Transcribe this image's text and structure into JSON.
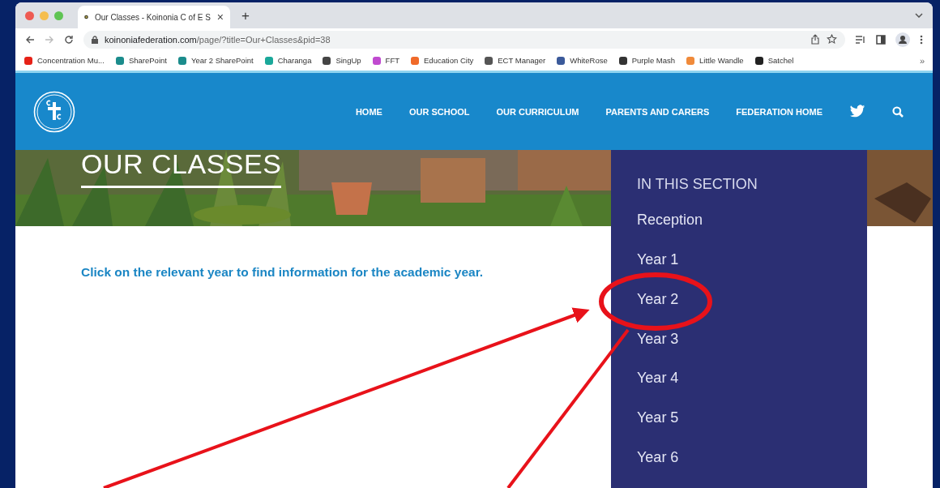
{
  "browser": {
    "tab_title": "Our Classes - Koinonia C of E S",
    "new_tab": "+",
    "close": "×",
    "url_host": "koinoniafederation.com",
    "url_path": "/page/?title=Our+Classes&pid=38",
    "bookmarks": [
      "Concentration Mu...",
      "SharePoint",
      "Year 2 SharePoint",
      "Charanga",
      "SingUp",
      "FFT",
      "Education City",
      "ECT Manager",
      "WhiteRose",
      "Purple Mash",
      "Little Wandle",
      "Satchel"
    ],
    "more": "»"
  },
  "site": {
    "nav": [
      "HOME",
      "OUR SCHOOL",
      "OUR CURRICULUM",
      "PARENTS AND CARERS",
      "FEDERATION HOME"
    ],
    "hero_title": "OUR CLASSES",
    "intro": "Click on the relevant year to find information for the academic year.",
    "section": {
      "heading": "IN THIS SECTION",
      "items": [
        "Reception",
        "Year 1",
        "Year 2",
        "Year 3",
        "Year 4",
        "Year 5",
        "Year 6"
      ]
    }
  }
}
